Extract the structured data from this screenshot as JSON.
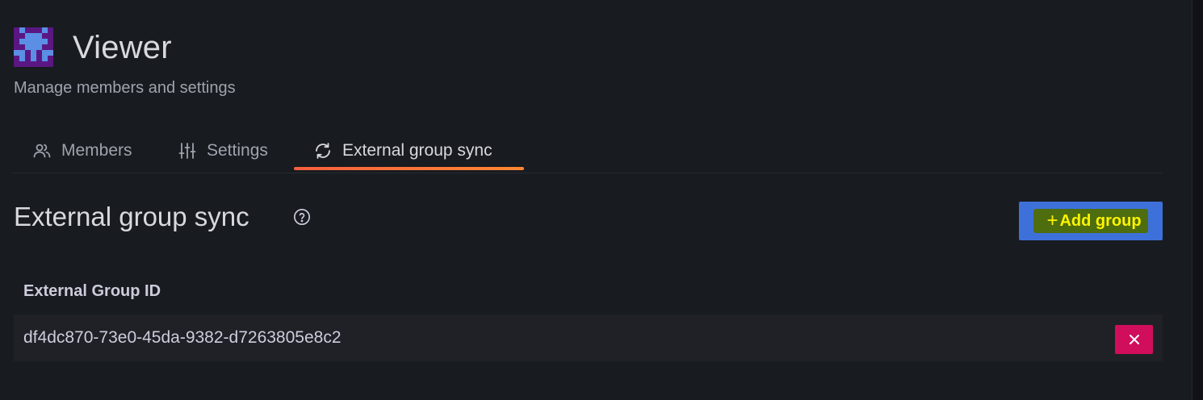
{
  "header": {
    "title": "Viewer",
    "subtitle": "Manage members and settings",
    "avatar_icon": "pixel-avatar-icon"
  },
  "tabs": [
    {
      "label": "Members",
      "icon": "users-icon",
      "active": false
    },
    {
      "label": "Settings",
      "icon": "sliders-icon",
      "active": false
    },
    {
      "label": "External group sync",
      "icon": "sync-icon",
      "active": true
    }
  ],
  "section": {
    "title": "External group sync",
    "help_icon": "question-circle-icon",
    "add_button_label": "Add group"
  },
  "table": {
    "column_header": "External Group ID",
    "rows": [
      {
        "group_id": "df4dc870-73e0-45da-9382-d7263805e8c2"
      }
    ]
  },
  "colors": {
    "accent_blue": "#3d71d9",
    "tab_underline": "#f55f3e",
    "delete_red": "#d10e5c",
    "highlight_green": "#4e6d0e",
    "highlight_text": "#fdf400"
  }
}
